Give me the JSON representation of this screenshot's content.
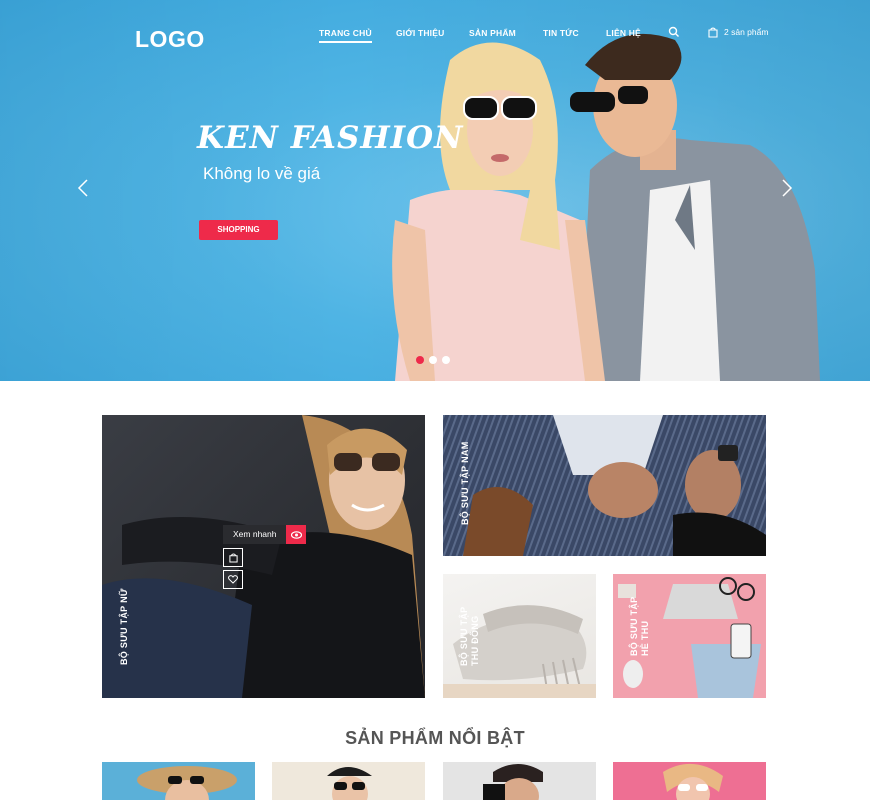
{
  "header": {
    "logo": "LOGO",
    "menu": [
      "TRANG CHỦ",
      "GIỚI THIỆU",
      "SẢN PHẨM",
      "TIN TỨC",
      "LIÊN HỆ"
    ],
    "cart_label": "2 sản phẩm",
    "icons": [
      "search-icon",
      "cart-icon"
    ]
  },
  "hero": {
    "title": "KEN FASHION",
    "subtitle": "Không lo về giá",
    "button": "SHOPPING",
    "active_slide": 1,
    "slide_count": 3
  },
  "collections": {
    "women": "BỘ SƯU TẬP NỮ",
    "men": "BỘ SƯU TẬP NAM",
    "fall_line1": "BỘ SƯU TẬP",
    "fall_line2": "THU ĐÔNG",
    "summer_line1": "BỘ SƯU TẬP",
    "summer_line2": "HÈ THU",
    "quick_view": "Xem nhanh"
  },
  "featured": {
    "title": "SẢN PHẨM NỔI BẬT"
  },
  "colors": {
    "accent": "#ee2a4a",
    "hero_bg": "#4fb4e4",
    "dark": "#2a2b2f"
  }
}
